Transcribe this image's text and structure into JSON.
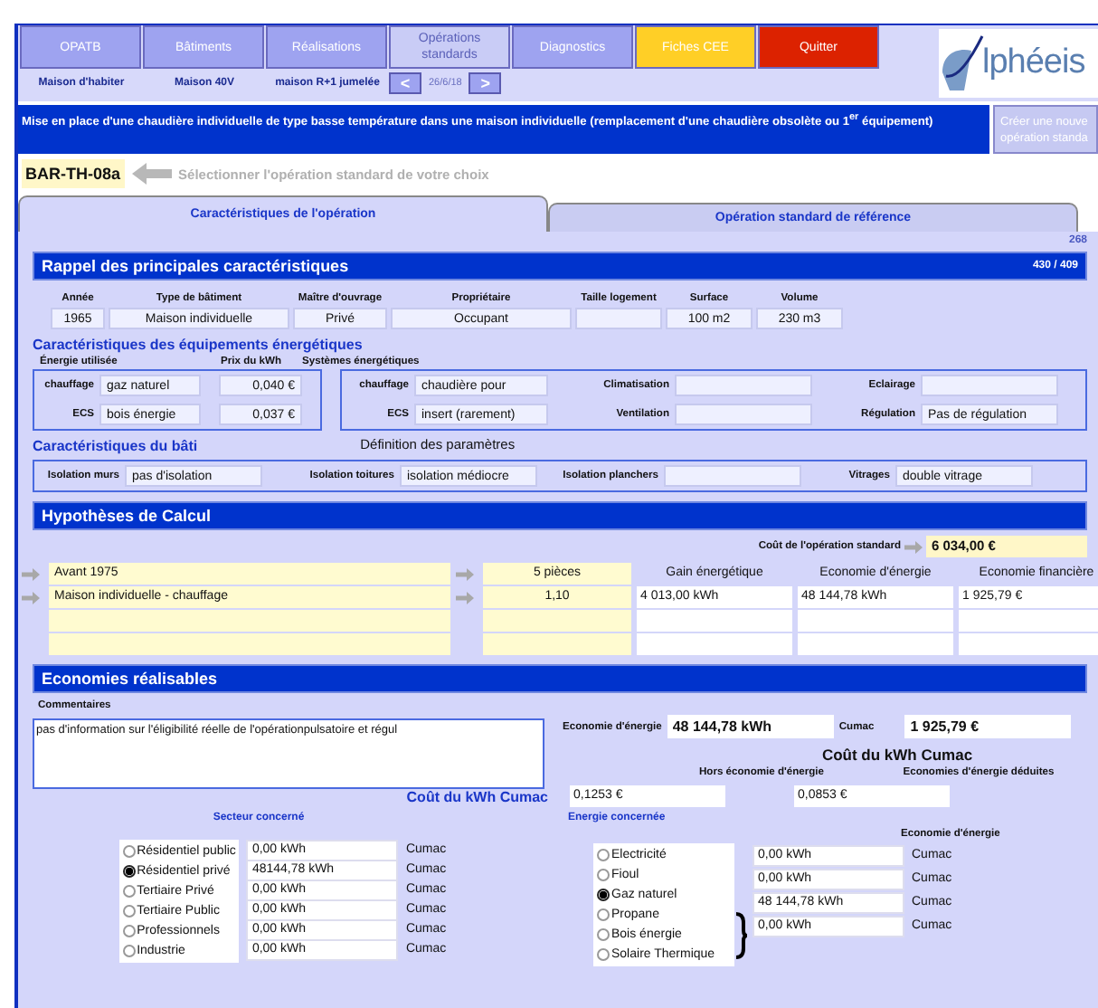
{
  "nav": {
    "buttons": [
      {
        "label": "OPATB",
        "kind": "normal"
      },
      {
        "label": "Bâtiments",
        "kind": "normal"
      },
      {
        "label": "Réalisations",
        "kind": "normal"
      },
      {
        "label": "Opérations standards",
        "kind": "disabled"
      },
      {
        "label": "Diagnostics",
        "kind": "normal"
      },
      {
        "label": "Fiches CEE",
        "kind": "yellow"
      },
      {
        "label": "Quitter",
        "kind": "red"
      }
    ],
    "captions": [
      "Maison d'habiter",
      "Maison 40V",
      "maison R+1 jumelée"
    ],
    "pager": {
      "prev": "<",
      "date": "26/6/18",
      "next": ">"
    },
    "logo": "lphéeis"
  },
  "banner": {
    "text": "Mise en place d'une chaudière individuelle de type basse température dans une maison individuelle (remplacement d'une chaudière obsolète ou 1$^{er}$ équipement)",
    "button": [
      "Créer une nouve",
      "opération standa"
    ]
  },
  "code": {
    "value": "BAR-TH-08a",
    "hint": "Sélectionner l'opération standard de votre choix"
  },
  "tabs": [
    {
      "label": "Caractéristiques de l'opération",
      "selected": true
    },
    {
      "label": "Opération standard de référence",
      "selected": false
    }
  ],
  "counter": "268",
  "rappel": {
    "title": "Rappel des principales caractéristiques",
    "count": "430  /  409",
    "columns": [
      {
        "label": "Année",
        "value": "1965"
      },
      {
        "label": "Type de bâtiment",
        "value": "Maison individuelle"
      },
      {
        "label": "Maître d'ouvrage",
        "value": "Privé"
      },
      {
        "label": "Propriétaire",
        "value": "Occupant"
      },
      {
        "label": "Taille logement"
      },
      {
        "label": "Surface",
        "value": "100 m2"
      },
      {
        "label": "Volume",
        "value": "230 m3"
      }
    ]
  },
  "equipements": {
    "title": "Caractéristiques des équipements énergétiques",
    "energy_header": "Énergie utilisée",
    "price_header": "Prix du kWh",
    "systems_header": "Systèmes énergétiques",
    "energies": [
      {
        "label": "chauffage",
        "value": "gaz naturel",
        "price": "0,040 €"
      },
      {
        "label": "ECS",
        "value": "bois énergie",
        "price": "0,037 €"
      }
    ],
    "systems": [
      {
        "label": "chauffage",
        "value": "chaudière pour"
      },
      {
        "label": "Climatisation"
      },
      {
        "label": "Eclairage"
      },
      {
        "label": "ECS",
        "value": "insert (rarement)"
      },
      {
        "label": "Ventilation"
      },
      {
        "label": "Régulation",
        "value": "Pas de régulation"
      }
    ]
  },
  "bati": {
    "title": "Caractéristiques du bâti",
    "note": "Définition des paramètres",
    "items": [
      {
        "label": "Isolation murs",
        "value": "pas d'isolation"
      },
      {
        "label": "Isolation toitures",
        "value": "isolation médiocre"
      },
      {
        "label": "Isolation planchers"
      },
      {
        "label": "Vitrages",
        "value": "double vitrage"
      }
    ]
  },
  "hypotheses": {
    "title": "Hypothèses de Calcul",
    "cost_label": "Coût de l'opération standard",
    "cost": "6 034,00 €",
    "headers": [
      "Gain énergétique",
      "Economie d'énergie",
      "Economie financière"
    ],
    "rows": [
      {
        "kind": "header",
        "label": "Avant 1975",
        "value": "5 pièces"
      },
      {
        "kind": "result",
        "label": "Maison individuelle - chauffage",
        "value": "1,10",
        "results": [
          "4 013,00 kWh",
          "48 144,78 kWh",
          "1 925,79 €"
        ]
      },
      {
        "kind": "blank"
      },
      {
        "kind": "blank"
      }
    ]
  },
  "economies": {
    "title": "Economies réalisables",
    "comments_label": "Commentaires",
    "comments": "pas d'information sur l'éligibilité réelle de l'opérationpulsatoire et régul",
    "energy_label": "Economie d'énergie",
    "energy": "48 144,78 kWh",
    "cumac_label": "Cumac",
    "cumac": "1 925,79 €",
    "cost_title": "Coût du kWh Cumac",
    "cost_headers": [
      "Hors économie d'énergie",
      "Economies d'énergie déduites"
    ],
    "cost_label": "Coût du kWh Cumac",
    "cost_values": [
      "0,1253 €",
      "0,0853 €"
    ]
  },
  "secteur": {
    "title": "Secteur concerné",
    "items": [
      {
        "label": "Résidentiel public",
        "selected": false,
        "value": "0,00 kWh",
        "unit": "Cumac"
      },
      {
        "label": "Résidentiel privé",
        "selected": true,
        "value": "48144,78 kWh",
        "unit": "Cumac"
      },
      {
        "label": "Tertiaire Privé",
        "selected": false,
        "value": "0,00 kWh",
        "unit": "Cumac"
      },
      {
        "label": "Tertiaire Public",
        "selected": false,
        "value": "0,00 kWh",
        "unit": "Cumac"
      },
      {
        "label": "Professionnels",
        "selected": false,
        "value": "0,00 kWh",
        "unit": "Cumac"
      },
      {
        "label": "Industrie",
        "selected": false,
        "value": "0,00 kWh",
        "unit": "Cumac"
      }
    ]
  },
  "energie": {
    "title": "Energie concernée",
    "header": "Economie d'énergie",
    "options": [
      {
        "label": "Electricité",
        "selected": false
      },
      {
        "label": "Fioul",
        "selected": false
      },
      {
        "label": "Gaz naturel",
        "selected": true
      },
      {
        "label": "Propane",
        "selected": false
      },
      {
        "label": "Bois énergie",
        "selected": false
      },
      {
        "label": "Solaire Thermique",
        "selected": false
      }
    ],
    "values": [
      {
        "value": "0,00 kWh",
        "unit": "Cumac"
      },
      {
        "value": "0,00 kWh",
        "unit": "Cumac"
      },
      {
        "value": "48 144,78 kWh",
        "unit": "Cumac"
      },
      {
        "value": "0,00 kWh",
        "unit": "Cumac"
      }
    ]
  }
}
